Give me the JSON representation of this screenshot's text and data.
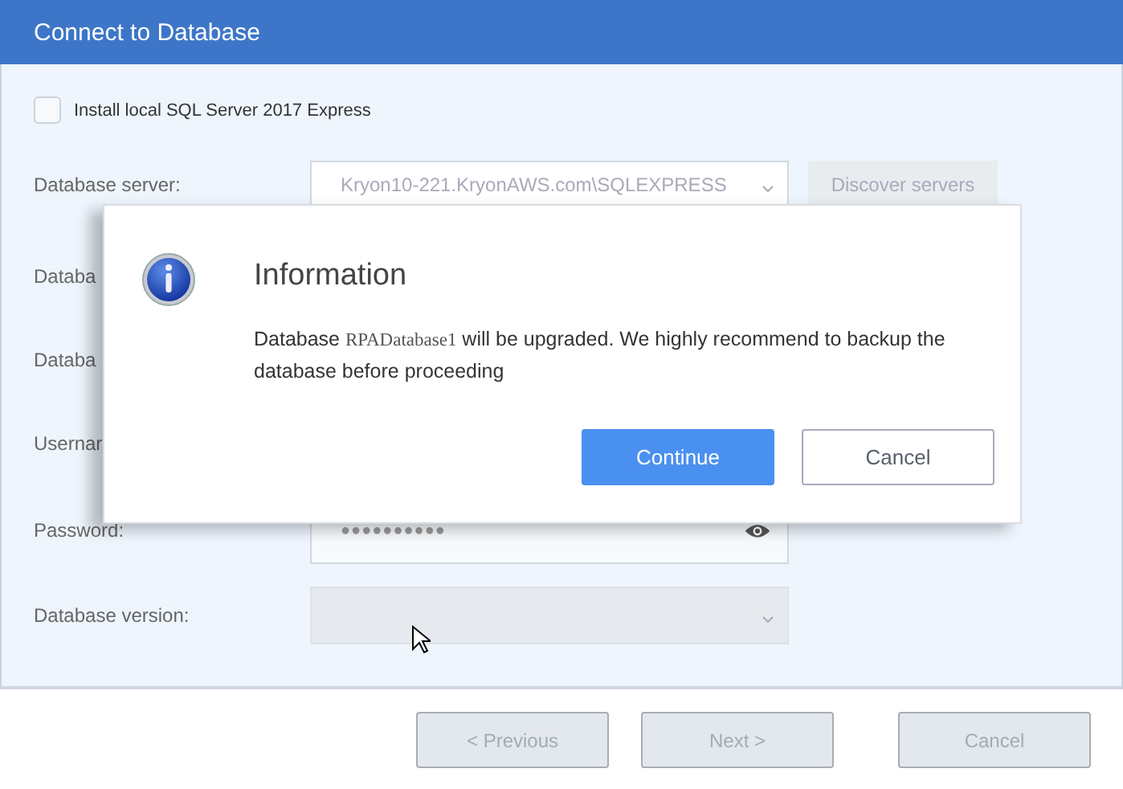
{
  "window": {
    "title": "Connect to Database"
  },
  "install_option": {
    "label": "Install local SQL Server 2017 Express",
    "checked": false
  },
  "form": [
    {
      "kind": "select",
      "label": "Database server:",
      "value": "Kryon10-221.KryonAWS.com\\SQLEXPRESS",
      "action": "Discover servers"
    },
    {
      "kind": "hidden",
      "label": "Databa"
    },
    {
      "kind": "hidden",
      "label": "Databa"
    },
    {
      "kind": "hidden",
      "label": "Usernar"
    },
    {
      "kind": "password",
      "label": "Password:",
      "value": "●●●●●●●●●●"
    },
    {
      "kind": "select",
      "label": "Database version:",
      "disabled": true
    }
  ],
  "footer_buttons": [
    {
      "label": "< Previous",
      "disabled": true
    },
    {
      "label": "Next >",
      "disabled": true
    },
    {
      "label": "Cancel",
      "disabled": true
    }
  ],
  "dialog": {
    "title": "Information",
    "message": [
      {
        "kind": "text",
        "text": "Database "
      },
      {
        "kind": "code",
        "text": "RPADatabase1"
      },
      {
        "kind": "text",
        "text": " will be upgraded. We highly recommend to backup the database before proceeding"
      }
    ],
    "buttons": [
      {
        "label": "Continue",
        "primary": true
      },
      {
        "label": "Cancel",
        "primary": false
      }
    ]
  }
}
